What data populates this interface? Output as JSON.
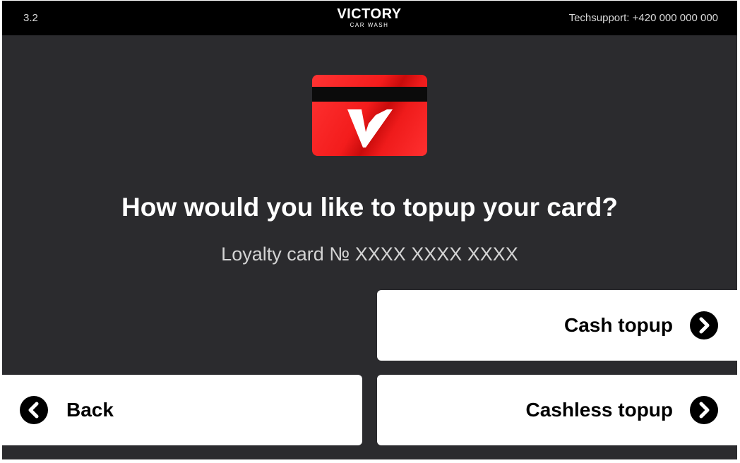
{
  "header": {
    "version": "3.2",
    "brand_name": "VICTORY",
    "brand_subtitle": "CAR WASH",
    "techsupport": "Techsupport: +420 000 000 000"
  },
  "main": {
    "question": "How would you like to topup your card?",
    "card_info": "Loyalty card № XXXX XXXX XXXX"
  },
  "actions": {
    "cash_label": "Cash topup",
    "cashless_label": "Cashless topup",
    "back_label": "Back"
  },
  "colors": {
    "background": "#2b2b2e",
    "topbar": "#000000",
    "card_red": "#f31c1c",
    "button": "#ffffff"
  }
}
